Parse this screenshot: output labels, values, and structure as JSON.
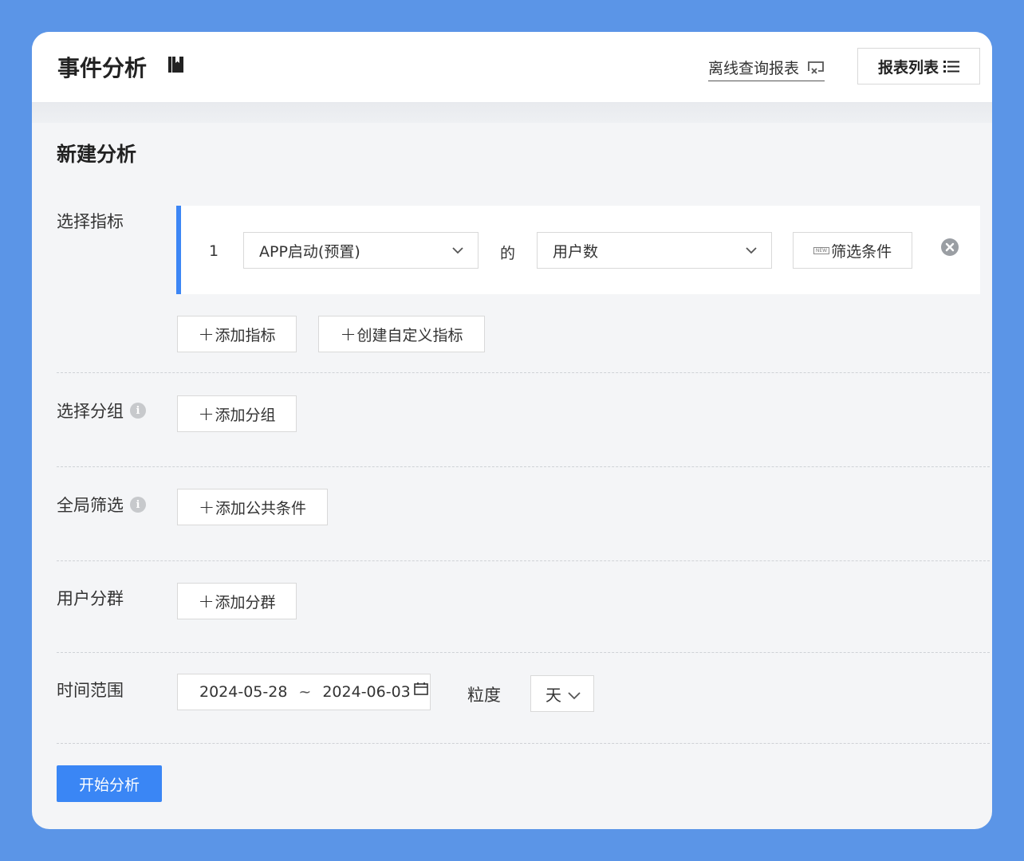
{
  "header": {
    "title": "事件分析",
    "offline_link": "离线查询报表",
    "report_list": "报表列表"
  },
  "section_title": "新建分析",
  "metrics": {
    "label": "选择指标",
    "items": [
      {
        "index": "1",
        "event": "APP启动(预置)",
        "of": "的",
        "measure": "用户数",
        "filter": "筛选条件"
      }
    ],
    "add_button": "添加指标",
    "custom_button": "创建自定义指标"
  },
  "group": {
    "label": "选择分组",
    "add_button": "添加分组"
  },
  "global_filter": {
    "label": "全局筛选",
    "add_button": "添加公共条件"
  },
  "segment": {
    "label": "用户分群",
    "add_button": "添加分群"
  },
  "time": {
    "label": "时间范围",
    "start": "2024-05-28",
    "separator": "~",
    "end": "2024-06-03",
    "granularity_label": "粒度",
    "granularity": "天"
  },
  "start_button": "开始分析",
  "colors": {
    "accent": "#3a86f5",
    "background": "#5b95e7"
  },
  "icons": [
    "book-icon",
    "offline-report-icon",
    "list-icon",
    "chevron-down-icon",
    "close-circle-icon",
    "info-icon",
    "calendar-icon",
    "plus-icon"
  ]
}
